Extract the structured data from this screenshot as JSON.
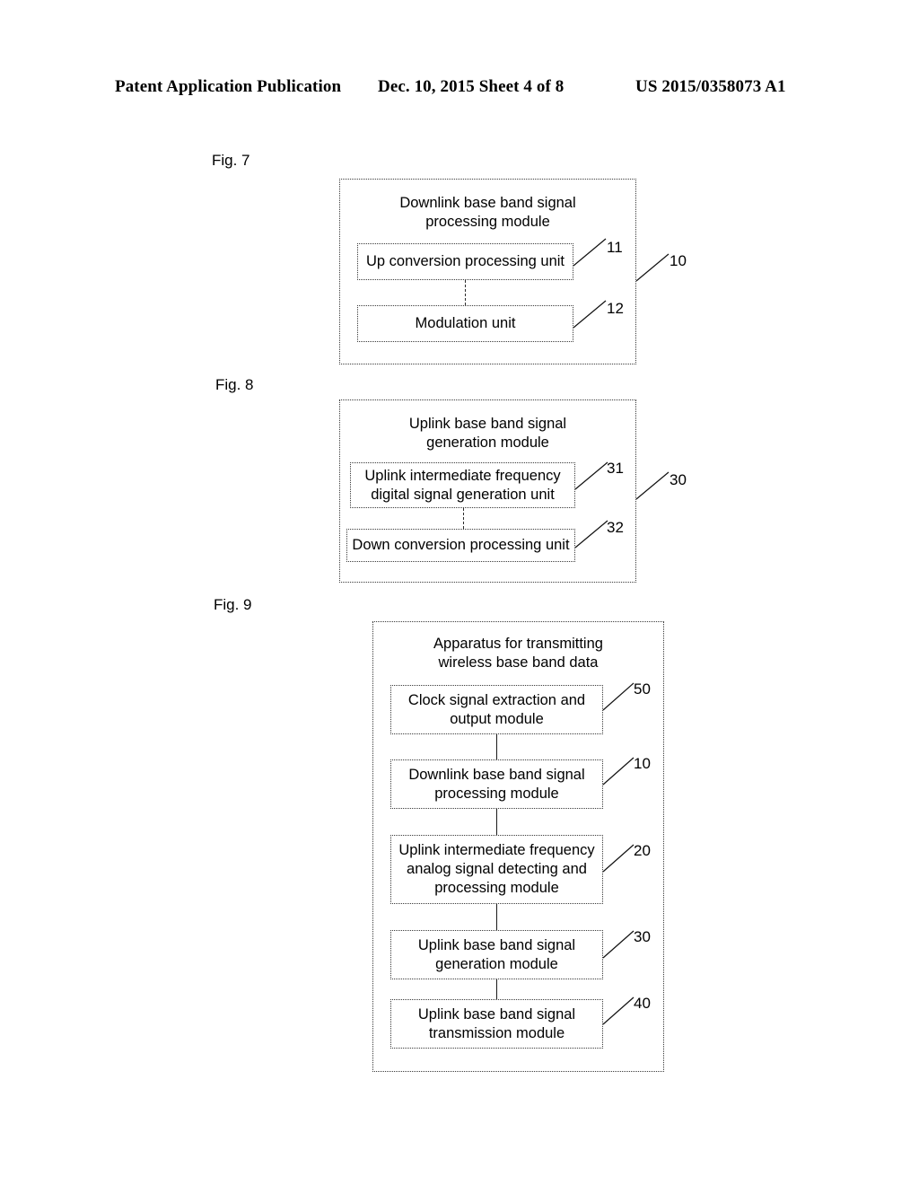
{
  "header": {
    "left": "Patent Application Publication",
    "middle": "Dec. 10, 2015  Sheet 4 of 8",
    "right": "US 2015/0358073 A1"
  },
  "figures": [
    {
      "label": "Fig. 7",
      "outer_title": "Downlink base band signal\nprocessing module",
      "outer_ref": "10",
      "units": [
        {
          "text": "Up conversion processing unit",
          "ref": "11"
        },
        {
          "text": "Modulation unit",
          "ref": "12"
        }
      ]
    },
    {
      "label": "Fig. 8",
      "outer_title": "Uplink base band signal\ngeneration module",
      "outer_ref": "30",
      "units": [
        {
          "text": "Uplink intermediate frequency\ndigital signal generation unit",
          "ref": "31"
        },
        {
          "text": "Down conversion processing unit",
          "ref": "32"
        }
      ]
    },
    {
      "label": "Fig. 9",
      "outer_title": "Apparatus for transmitting\nwireless base band data",
      "outer_ref": "",
      "units": [
        {
          "text": "Clock signal extraction and\noutput module",
          "ref": "50"
        },
        {
          "text": "Downlink base band signal\nprocessing module",
          "ref": "10"
        },
        {
          "text": "Uplink intermediate frequency\nanalog signal detecting and\nprocessing module",
          "ref": "20"
        },
        {
          "text": "Uplink base band signal\ngeneration module",
          "ref": "30"
        },
        {
          "text": "Uplink base band signal\ntransmission module",
          "ref": "40"
        }
      ]
    }
  ],
  "colors": {
    "ink": "#000000",
    "box_border": "#3a3a3a",
    "paper": "#ffffff"
  }
}
